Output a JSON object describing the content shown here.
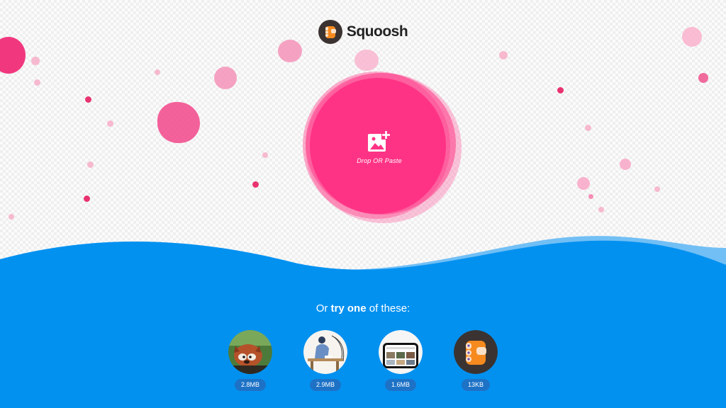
{
  "header": {
    "app_name": "Squoosh",
    "logo_icon": "squoosh-hand-logo-icon"
  },
  "drop_zone": {
    "label": "Drop OR Paste",
    "icon": "add-image-icon"
  },
  "samples_section": {
    "heading_prefix": "Or ",
    "heading_bold": "try one",
    "heading_suffix": " of these:",
    "items": [
      {
        "subject": "red panda photo",
        "size": "2.8MB"
      },
      {
        "subject": "woman at table illustration",
        "size": "2.9MB"
      },
      {
        "subject": "phone screenshot",
        "size": "1.6MB"
      },
      {
        "subject": "squoosh logo",
        "size": "13KB"
      }
    ]
  },
  "colors": {
    "accent_pink": "#ff3385",
    "water_blue": "#0391f0",
    "water_light": "#71bff5",
    "pill_blue": "#1d72c6"
  }
}
